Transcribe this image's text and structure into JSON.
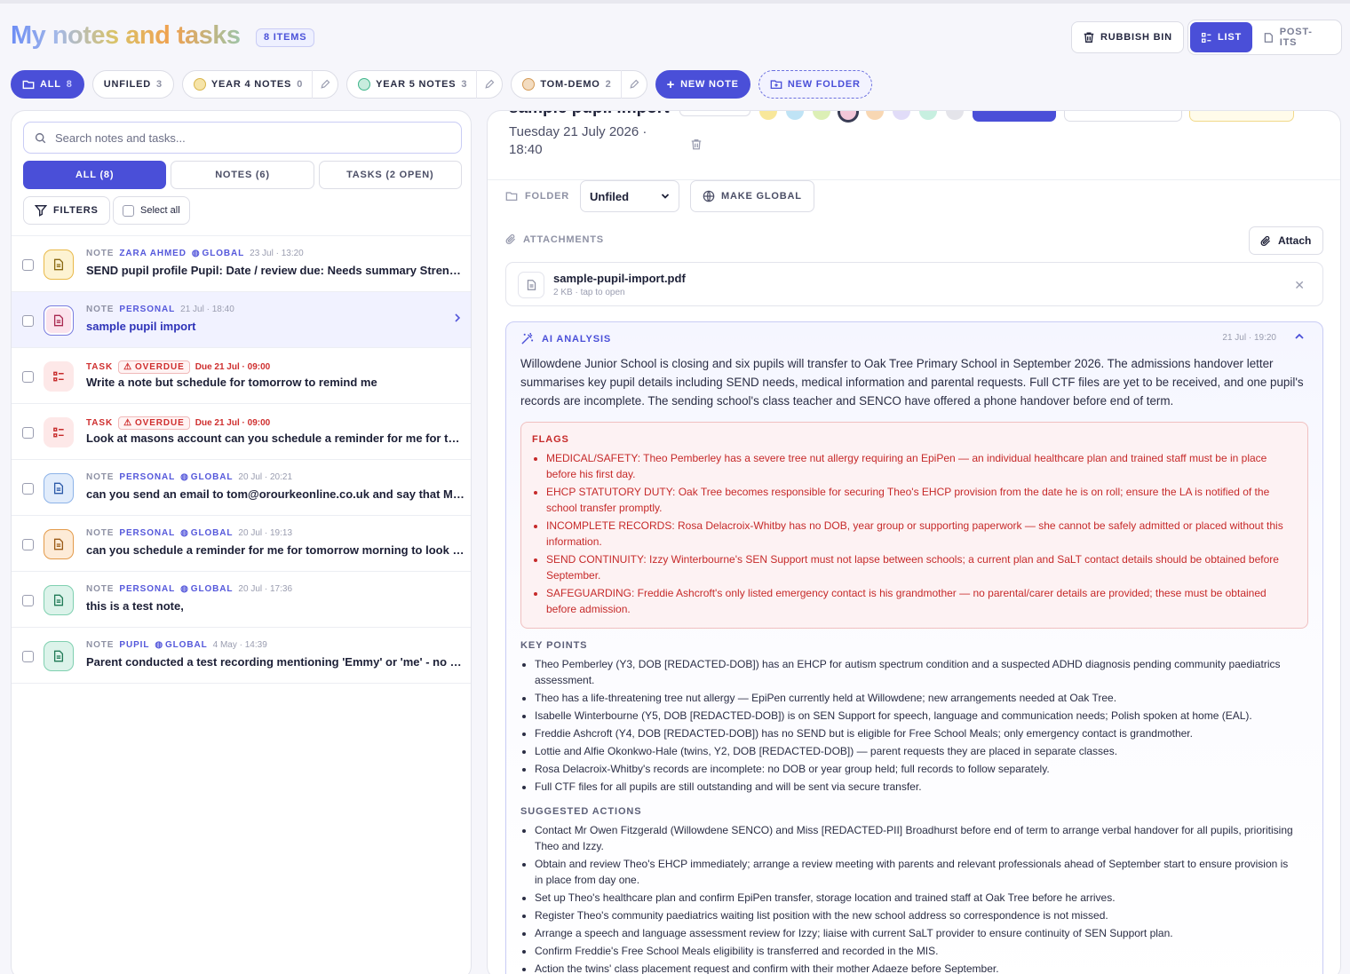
{
  "header": {
    "title": "My notes and tasks",
    "count_badge": "8 ITEMS",
    "rubbish_bin": "RUBBISH BIN",
    "view_list": "LIST",
    "view_postits": "POST-ITS"
  },
  "folder_tabs": [
    {
      "label": "ALL",
      "count": "8"
    },
    {
      "label": "UNFILED",
      "count": "3"
    },
    {
      "label": "YEAR 4 NOTES",
      "count": "0"
    },
    {
      "label": "YEAR 5 NOTES",
      "count": "3"
    },
    {
      "label": "TOM-DEMO",
      "count": "2"
    }
  ],
  "actions": {
    "new_note": "NEW NOTE",
    "new_folder": "NEW FOLDER"
  },
  "search": {
    "placeholder": "Search notes and tasks..."
  },
  "filter_tabs": [
    "ALL (8)",
    "NOTES (6)",
    "TASKS (2 OPEN)"
  ],
  "filters_label": "FILTERS",
  "select_all": "Select all",
  "items": [
    {
      "kind": "NOTE",
      "who": "ZARA AHMED",
      "global": "GLOBAL",
      "date": "23 Jul · 13:20",
      "title": "SEND pupil profile Pupil: Date / review due: Needs summary Strengths / interests: Barriers",
      "color": "#e9b949"
    },
    {
      "kind": "NOTE",
      "who": "PERSONAL",
      "date": "21 Jul · 18:40",
      "title": "sample pupil import",
      "color": "#d14a7a"
    },
    {
      "kind": "TASK",
      "overdue": "OVERDUE",
      "due": "Due 21 Jul · 09:00",
      "title": "Write a note but schedule for tomorrow to remind me",
      "color": "#e06a6a"
    },
    {
      "kind": "TASK",
      "overdue": "OVERDUE",
      "due": "Due 21 Jul · 09:00",
      "title": "Look at masons account can you schedule a reminder for me for tomorrow",
      "color": "#e06a6a"
    },
    {
      "kind": "NOTE",
      "who": "PERSONAL",
      "global": "GLOBAL",
      "date": "20 Jul · 20:21",
      "title": "can you send an email to tom@orourkeonline.co.uk and say that Mason is doing well",
      "color": "#5b8fd6"
    },
    {
      "kind": "NOTE",
      "who": "PERSONAL",
      "global": "GLOBAL",
      "date": "20 Jul · 19:13",
      "title": "can you schedule a reminder for me for tomorrow morning to look at the accounts",
      "color": "#e39a4a"
    },
    {
      "kind": "NOTE",
      "who": "PERSONAL",
      "global": "GLOBAL",
      "date": "20 Jul · 17:36",
      "title": "this is a test note,",
      "color": "#3fb58a"
    },
    {
      "kind": "NOTE",
      "who": "PUPIL",
      "global": "GLOBAL",
      "date": "4 May · 14:39",
      "title": "Parent conducted a test recording mentioning 'Emmy' or 'me' - no further details given",
      "color": "#3fb58a"
    }
  ],
  "detail": {
    "title": "sample pupil import",
    "date": "Tuesday 21 July 2026 · 18:40",
    "folder_label": "FOLDER",
    "folder_value": "Unfiled",
    "make_global": "MAKE GLOBAL",
    "attachments_label": "ATTACHMENTS",
    "attach_button": "Attach",
    "file_name": "sample-pupil-import.pdf",
    "file_sub": "2 KB · tap to open",
    "ai_label": "AI ANALYSIS",
    "ai_time": "21 Jul · 19:20",
    "summary": "Willowdene Junior School is closing and six pupils will transfer to Oak Tree Primary School in September 2026. The admissions handover letter summarises key pupil details including SEND needs, medical information and parental requests. Full CTF files are yet to be received, and one pupil's records are incomplete. The sending school's class teacher and SENCO have offered a phone handover before end of term.",
    "flags_label": "FLAGS",
    "flags": [
      "MEDICAL/SAFETY: Theo Pemberley has a severe tree nut allergy requiring an EpiPen — an individual healthcare plan and trained staff must be in place before his first day.",
      "EHCP STATUTORY DUTY: Oak Tree becomes responsible for securing Theo's EHCP provision from the date he is on roll; ensure the LA is notified of the school transfer promptly.",
      "INCOMPLETE RECORDS: Rosa Delacroix-Whitby has no DOB, year group or supporting paperwork — she cannot be safely admitted or placed without this information.",
      "SEND CONTINUITY: Izzy Winterbourne's SEN Support must not lapse between schools; a current plan and SaLT contact details should be obtained before September.",
      "SAFEGUARDING: Freddie Ashcroft's only listed emergency contact is his grandmother — no parental/carer details are provided; these must be obtained before admission."
    ],
    "key_points_label": "KEY POINTS",
    "key_points": [
      "Theo Pemberley (Y3, DOB [REDACTED-DOB]) has an EHCP for autism spectrum condition and a suspected ADHD diagnosis pending community paediatrics assessment.",
      "Theo has a life-threatening tree nut allergy — EpiPen currently held at Willowdene; new arrangements needed at Oak Tree.",
      "Isabelle Winterbourne (Y5, DOB [REDACTED-DOB]) is on SEN Support for speech, language and communication needs; Polish spoken at home (EAL).",
      "Freddie Ashcroft (Y4, DOB [REDACTED-DOB]) has no SEND but is eligible for Free School Meals; only emergency contact is grandmother.",
      "Lottie and Alfie Okonkwo-Hale (twins, Y2, DOB [REDACTED-DOB]) — parent requests they are placed in separate classes.",
      "Rosa Delacroix-Whitby's records are incomplete: no DOB or year group held; full records to follow separately.",
      "Full CTF files for all pupils are still outstanding and will be sent via secure transfer."
    ],
    "actions_label": "SUGGESTED ACTIONS",
    "actions": [
      "Contact Mr Owen Fitzgerald (Willowdene SENCO) and Miss [REDACTED-PII] Broadhurst before end of term to arrange verbal handover for all pupils, prioritising Theo and Izzy.",
      "Obtain and review Theo's EHCP immediately; arrange a review meeting with parents and relevant professionals ahead of September start to ensure provision is in place from day one.",
      "Set up Theo's healthcare plan and confirm EpiPen transfer, storage location and trained staff at Oak Tree before he arrives.",
      "Register Theo's community paediatrics waiting list position with the new school address so correspondence is not missed.",
      "Arrange a speech and language assessment review for Izzy; liaise with current SaLT provider to ensure continuity of SEN Support plan.",
      "Confirm Freddie's Free School Meals eligibility is transferred and recorded in the MIS.",
      "Action the twins' class placement request and confirm with their mother Adaeze before September."
    ]
  },
  "colors": {
    "accent": "#4a4fd8",
    "danger": "#c62a2a"
  }
}
